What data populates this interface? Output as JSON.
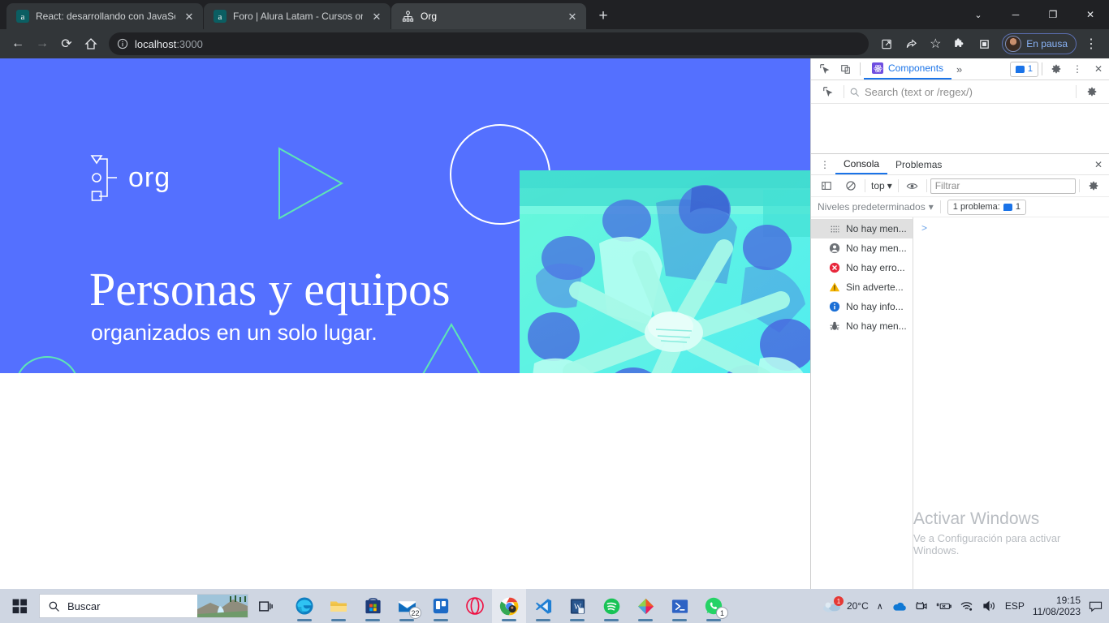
{
  "browser": {
    "tabs": [
      {
        "title": "React: desarrollando con JavaScri",
        "favicon": "alura-a-icon",
        "active": false,
        "close_label": "✕"
      },
      {
        "title": "Foro | Alura Latam - Cursos onlin",
        "favicon": "alura-a-icon",
        "active": false,
        "close_label": "✕"
      },
      {
        "title": "Org",
        "favicon": "org-chart-icon",
        "active": true,
        "close_label": "✕"
      }
    ],
    "new_tab_label": "+",
    "window_controls": {
      "chevron": "⌄",
      "minimize": "─",
      "maximize": "❐",
      "close": "✕"
    },
    "toolbar": {
      "back": "←",
      "forward": "→",
      "reload": "⟳",
      "home": "⌂",
      "site_info": "ⓘ",
      "url_host": "localhost",
      "url_port": ":3000",
      "split_screen": "split-screen-icon",
      "share": "share-icon",
      "favorite": "☆",
      "extensions": "extensions-icon",
      "collections": "collections-icon",
      "profile_label": "En pausa",
      "settings_more": "⋮"
    }
  },
  "page": {
    "logo_word": "org",
    "headline": "Personas y equipos",
    "subhead": "organizados en un solo lugar.",
    "colors": {
      "banner_blue": "#5470ff",
      "accent_green": "#5ee6b5",
      "photo_cyan": "#49f2c8",
      "white": "#ffffff"
    },
    "hero_image_alt": "equipo juntando las manos"
  },
  "devtools": {
    "toolbar": {
      "inspect_icon": "inspect-element-icon",
      "device_toggle_icon": "device-toolbar-icon",
      "tab_label": "Components",
      "more_tabs": "»",
      "issues_count": "1",
      "settings_icon": "gear-icon",
      "more_icon": "⋮",
      "close_icon": "✕"
    },
    "react_panel": {
      "select_icon": "select-component-icon",
      "search_icon": "search-icon",
      "search_placeholder": "Search (text or /regex/)",
      "settings_icon": "gear-icon"
    },
    "console": {
      "menu_icon": "⋮",
      "tabs": [
        {
          "label": "Consola",
          "active": true
        },
        {
          "label": "Problemas",
          "active": false
        }
      ],
      "close_icon": "✕",
      "sidebar_toggle_icon": "show-console-sidebar-icon",
      "clear_icon": "clear-console-icon",
      "context": "top",
      "context_caret": "▾",
      "eye_icon": "live-expression-icon",
      "filter_placeholder": "Filtrar",
      "settings_icon": "gear-icon",
      "levels_label": "Niveles predeterminados",
      "levels_caret": "▾",
      "issues_label": "1 problema:",
      "issues_count": "1",
      "prompt": ">",
      "sidebar_items": [
        {
          "label": "No hay men...",
          "icon": "list-icon",
          "selected": true
        },
        {
          "label": "No hay men...",
          "icon": "user-icon",
          "selected": false
        },
        {
          "label": "No hay erro...",
          "icon": "error-icon",
          "selected": false
        },
        {
          "label": "Sin adverte...",
          "icon": "warning-icon",
          "selected": false
        },
        {
          "label": "No hay info...",
          "icon": "info-icon",
          "selected": false
        },
        {
          "label": "No hay men...",
          "icon": "bug-icon",
          "selected": false
        }
      ]
    }
  },
  "watermark": {
    "title": "Activar Windows",
    "subtitle": "Ve a Configuración para activar Windows."
  },
  "taskbar": {
    "start_icon": "windows-start-icon",
    "search_placeholder": "Buscar",
    "search_icon": "search-icon",
    "task_view_icon": "task-view-icon",
    "apps": [
      {
        "name": "microsoft-edge",
        "badge": ""
      },
      {
        "name": "file-explorer",
        "badge": ""
      },
      {
        "name": "microsoft-store",
        "badge": ""
      },
      {
        "name": "mail",
        "badge": "22"
      },
      {
        "name": "trello",
        "badge": ""
      },
      {
        "name": "opera",
        "badge": ""
      },
      {
        "name": "google-chrome",
        "badge": ""
      },
      {
        "name": "visual-studio-code",
        "badge": ""
      },
      {
        "name": "microsoft-word",
        "badge": ""
      },
      {
        "name": "spotify",
        "badge": ""
      },
      {
        "name": "adobe-app",
        "badge": ""
      },
      {
        "name": "powershell",
        "badge": ""
      },
      {
        "name": "whatsapp",
        "badge": "1"
      }
    ],
    "tray": {
      "weather_temp": "20°C",
      "weather_badge": "1",
      "overflow_caret": "∧",
      "onedrive_icon": "onedrive-icon",
      "camera_icon": "camera-icon",
      "battery_icon": "battery-icon",
      "network_icon": "wifi-icon",
      "volume_icon": "speaker-icon",
      "language": "ESP",
      "time": "19:15",
      "date": "11/08/2023",
      "notifications_icon": "notification-icon"
    }
  }
}
